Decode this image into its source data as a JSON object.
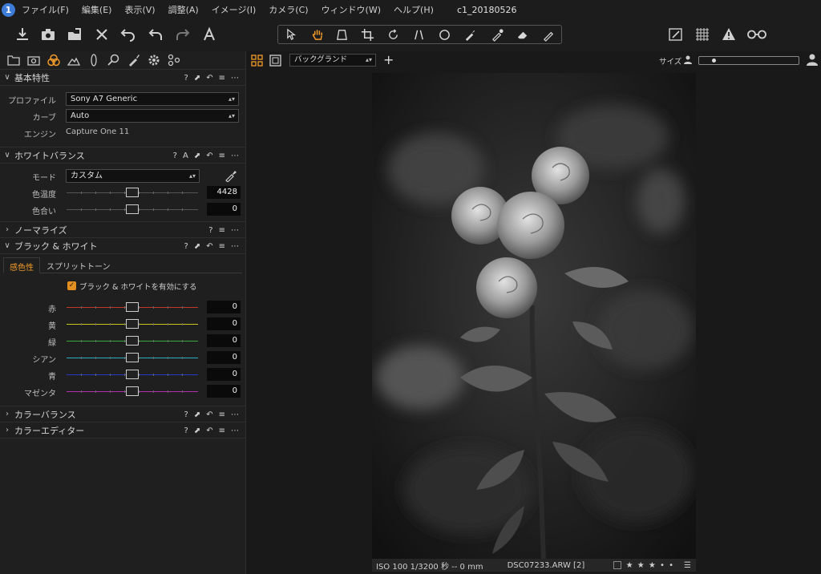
{
  "menu": {
    "items": [
      "ファイル(F)",
      "編集(E)",
      "表示(V)",
      "調整(A)",
      "イメージ(I)",
      "カメラ(C)",
      "ウィンドウ(W)",
      "ヘルプ(H)"
    ],
    "title": "c1_20180526",
    "logo": "1"
  },
  "viewer": {
    "background_select": "バックグランド",
    "size_label": "サイズ",
    "status_exif": "ISO 100  1/3200 秒  -- 0 mm",
    "status_file": "DSC07233.ARW [2]",
    "stars": "★ ★ ★ • •"
  },
  "panel": {
    "basic": {
      "title": "基本特性",
      "profile_label": "プロファイル",
      "profile_value": "Sony A7 Generic",
      "curve_label": "カーブ",
      "curve_value": "Auto",
      "engine_label": "エンジン",
      "engine_value": "Capture One 11"
    },
    "wb": {
      "title": "ホワイトバランス",
      "mode_label": "モード",
      "mode_value": "カスタム",
      "temp_label": "色温度",
      "temp_value": "4428",
      "tint_label": "色合い",
      "tint_value": "0",
      "auto_icon": "A"
    },
    "normalize": {
      "title": "ノーマライズ"
    },
    "bw": {
      "title": "ブラック & ホワイト",
      "tab_sensitivity": "感色性",
      "tab_split": "スプリットトーン",
      "enable_label": "ブラック & ホワイトを有効にする",
      "channels": [
        {
          "label": "赤",
          "value": "0",
          "color": "#c0392b"
        },
        {
          "label": "黄",
          "value": "0",
          "color": "#c8c820"
        },
        {
          "label": "緑",
          "value": "0",
          "color": "#3aa83a"
        },
        {
          "label": "シアン",
          "value": "0",
          "color": "#2ab0c0"
        },
        {
          "label": "青",
          "value": "0",
          "color": "#2a3ac8"
        },
        {
          "label": "マゼンタ",
          "value": "0",
          "color": "#b030b0"
        }
      ]
    },
    "color_balance": {
      "title": "カラーバランス"
    },
    "color_editor": {
      "title": "カラーエディター"
    }
  },
  "colors": {
    "accent": "#f09a2a",
    "logo": "#3d7dd8"
  }
}
